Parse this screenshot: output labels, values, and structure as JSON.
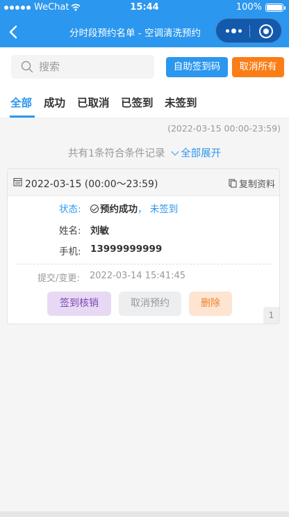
{
  "status_bar": {
    "carrier": "WeChat",
    "time": "15:44",
    "battery": "100%"
  },
  "nav": {
    "title": "分时段预约名单 - 空调清洗预约"
  },
  "search": {
    "placeholder": "搜索",
    "value": ""
  },
  "toolbar": {
    "checkin_code_label": "自助签到码",
    "cancel_all_label": "取消所有"
  },
  "tabs": [
    {
      "label": "全部",
      "active": true
    },
    {
      "label": "成功"
    },
    {
      "label": "已取消"
    },
    {
      "label": "已签到"
    },
    {
      "label": "未签到"
    }
  ],
  "range_text": "(2022-03-15 00:00-23:59)",
  "summary": {
    "text": "共有1条符合条件记录",
    "expand_label": "全部展开"
  },
  "record": {
    "date_text": "2022-03-15 (00:00～23:59)",
    "copy_label": "复制资料",
    "status_label": "状态:",
    "status_value": "预约成功",
    "status_separator": "，",
    "sign_status": "未签到",
    "name_label": "姓名:",
    "name_value": "刘敏",
    "phone_label": "手机:",
    "phone_value": "13999999999",
    "submit_label": "提交/变更:",
    "submit_value": "2022-03-14 15:41:45",
    "action_checkin": "签到核销",
    "action_cancel": "取消预约",
    "action_delete": "删除",
    "index": "1"
  },
  "colors": {
    "primary": "#2b97ee",
    "orange": "#fa7d17"
  }
}
